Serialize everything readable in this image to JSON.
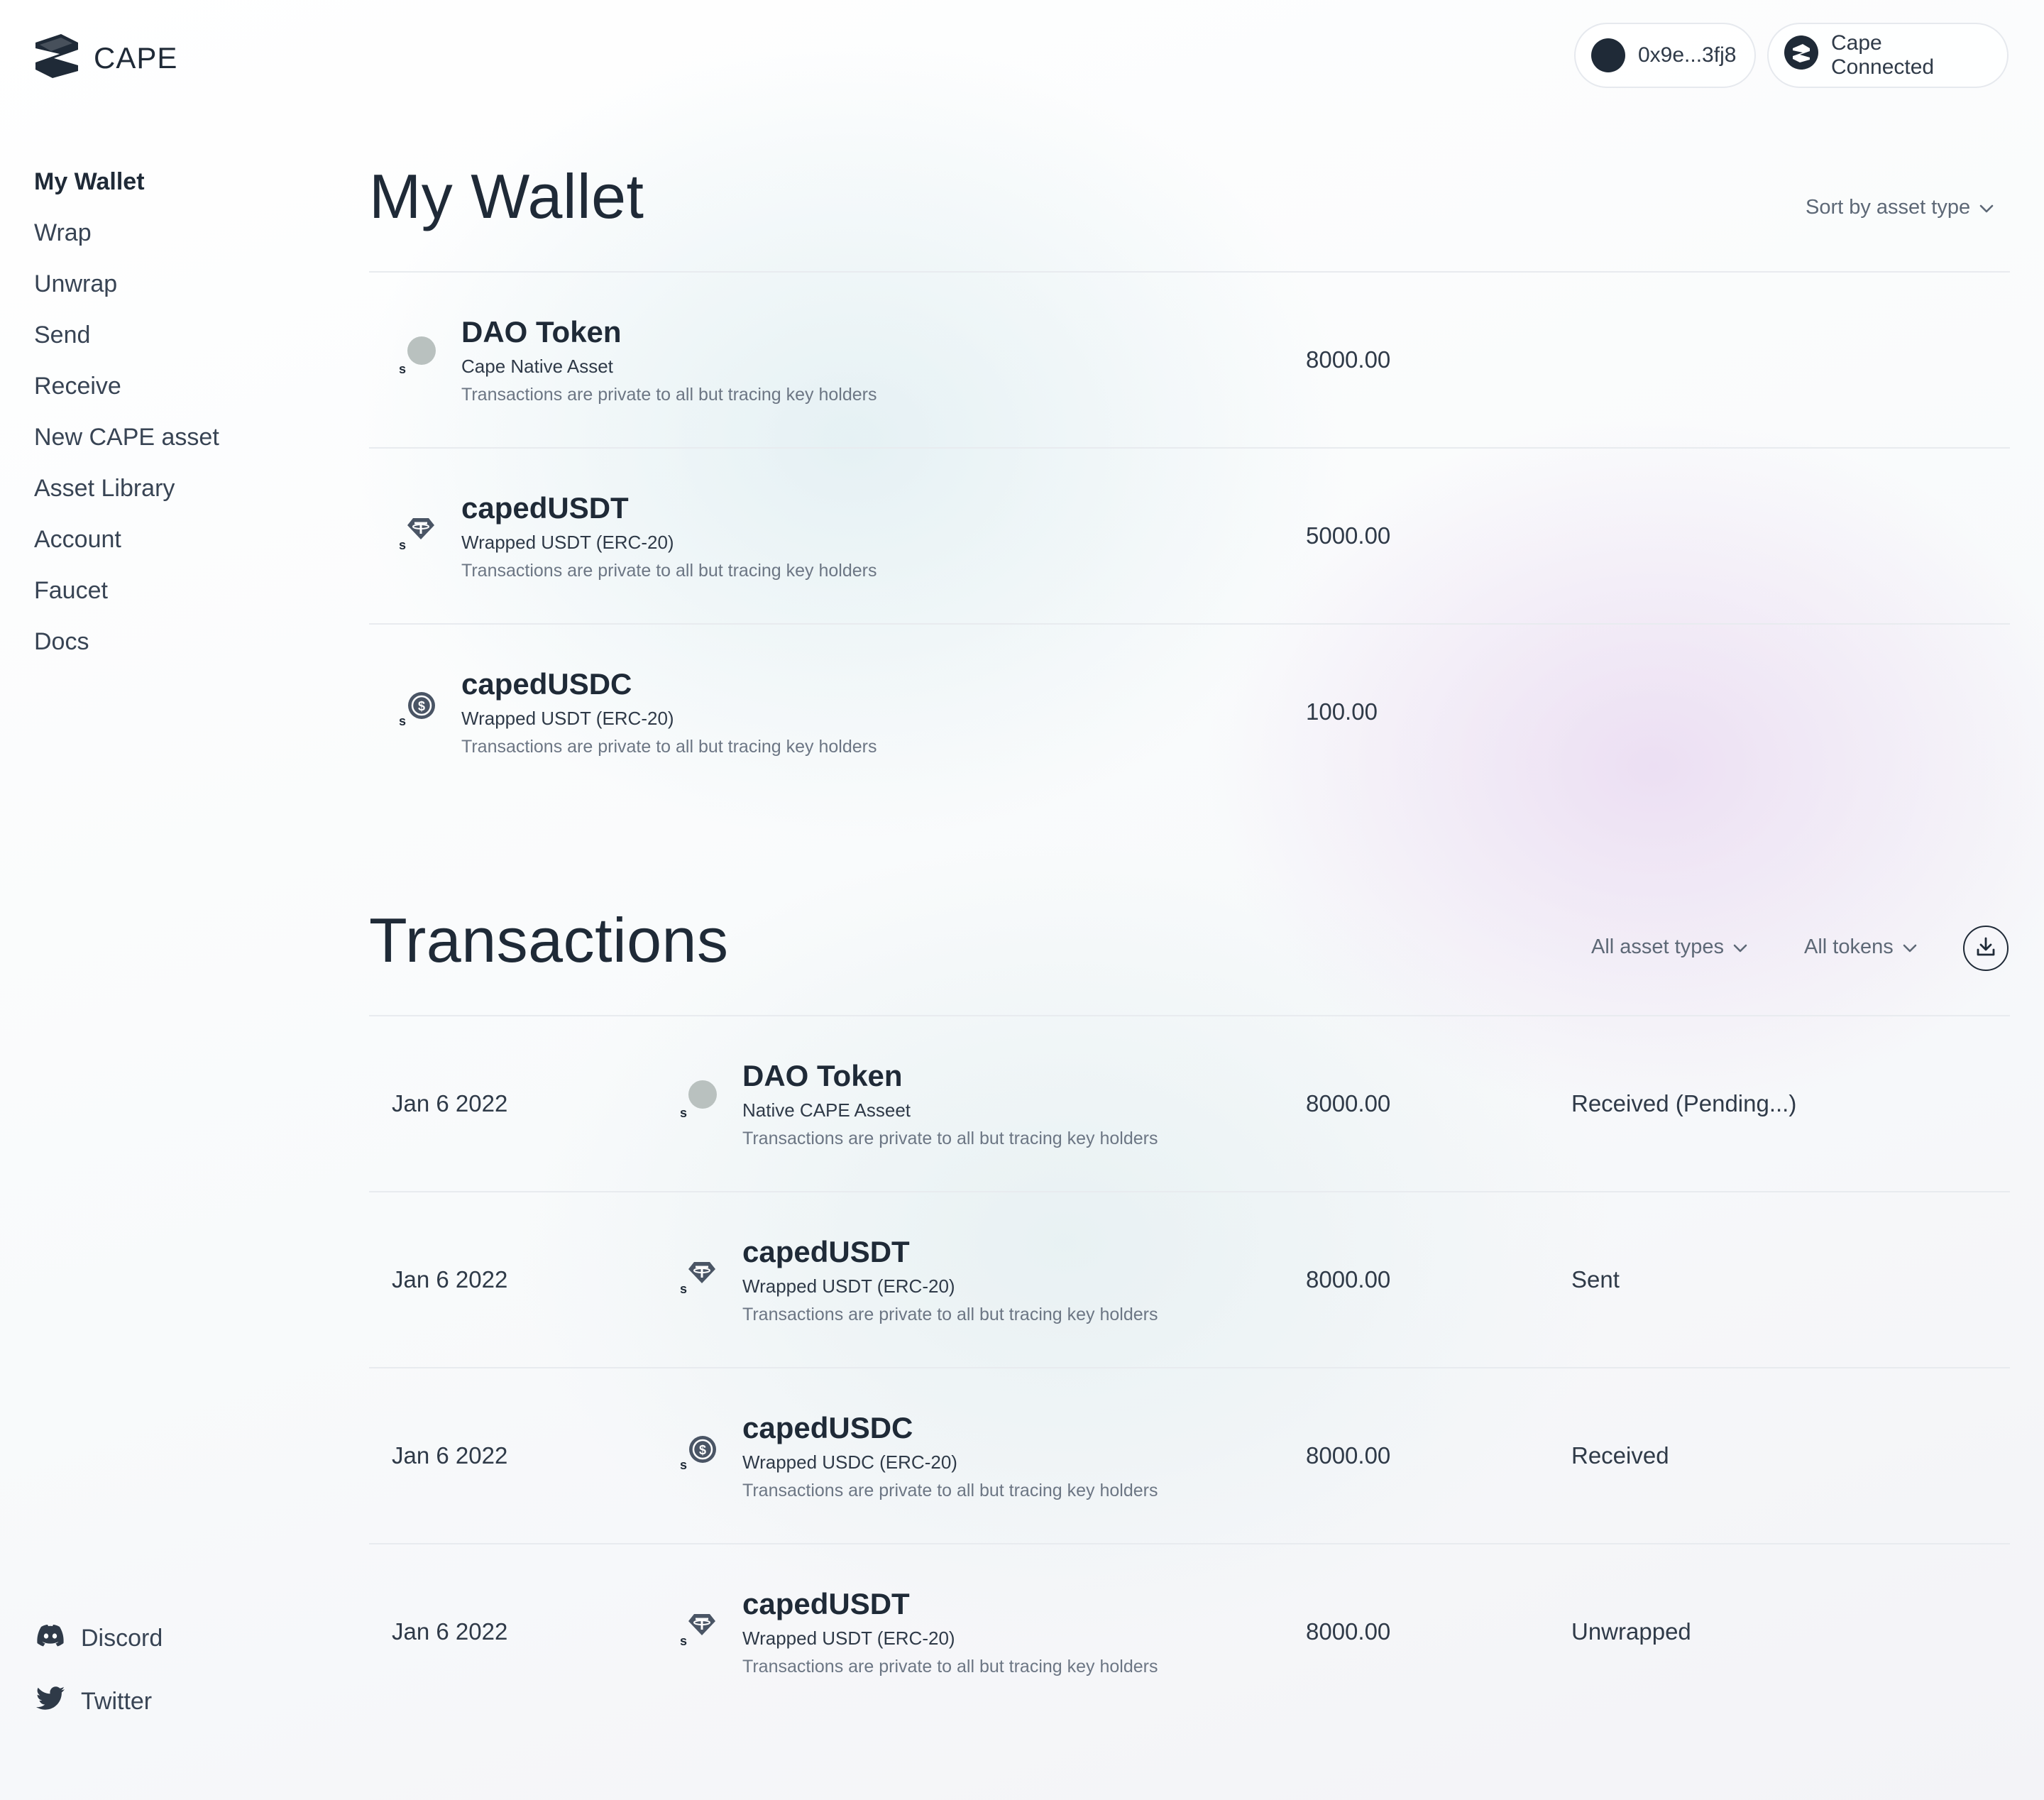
{
  "brand": {
    "name": "CAPE",
    "logo_icon": "cape-logo-icon"
  },
  "header": {
    "wallet_address": "0x9e...3fj8",
    "connection_label": "Cape Connected"
  },
  "sidebar": {
    "items": [
      {
        "label": "My Wallet",
        "active": true
      },
      {
        "label": "Wrap"
      },
      {
        "label": "Unwrap"
      },
      {
        "label": "Send"
      },
      {
        "label": "Receive"
      },
      {
        "label": "New CAPE asset"
      },
      {
        "label": "Asset Library"
      },
      {
        "label": "Account"
      },
      {
        "label": "Faucet"
      },
      {
        "label": "Docs"
      }
    ],
    "social": [
      {
        "label": "Discord",
        "icon": "discord-icon"
      },
      {
        "label": "Twitter",
        "icon": "twitter-icon"
      }
    ]
  },
  "wallet": {
    "title": "My Wallet",
    "sort_label": "Sort by asset type",
    "assets": [
      {
        "name": "DAO Token",
        "type": "Cape Native Asset",
        "note": "Transactions are private to all but tracing key holders",
        "amount": "8000.00",
        "icon": "dao-token-icon"
      },
      {
        "name": "capedUSDT",
        "type": "Wrapped USDT (ERC-20)",
        "note": "Transactions are private to all but tracing key holders",
        "amount": "5000.00",
        "icon": "usdt-icon"
      },
      {
        "name": "capedUSDC",
        "type": "Wrapped USDT (ERC-20)",
        "note": "Transactions are private to all but tracing key holders",
        "amount": "100.00",
        "icon": "usdc-icon"
      }
    ]
  },
  "transactions": {
    "title": "Transactions",
    "filter_asset_types": "All asset types",
    "filter_tokens": "All tokens",
    "download_icon": "download-icon",
    "rows": [
      {
        "date": "Jan 6 2022",
        "name": "DAO Token",
        "type": "Native CAPE Asseet",
        "note": "Transactions are private to all but tracing key holders",
        "amount": "8000.00",
        "status": "Received (Pending...)",
        "icon": "dao-token-icon"
      },
      {
        "date": "Jan 6 2022",
        "name": "capedUSDT",
        "type": "Wrapped USDT (ERC-20)",
        "note": "Transactions are private to all but tracing key holders",
        "amount": "8000.00",
        "status": "Sent",
        "icon": "usdt-icon"
      },
      {
        "date": "Jan 6 2022",
        "name": "capedUSDC",
        "type": "Wrapped USDC (ERC-20)",
        "note": "Transactions are private to all but tracing key holders",
        "amount": "8000.00",
        "status": "Received",
        "icon": "usdc-icon"
      },
      {
        "date": "Jan 6 2022",
        "name": "capedUSDT",
        "type": "Wrapped USDT (ERC-20)",
        "note": "Transactions are private to all but tracing key holders",
        "amount": "8000.00",
        "status": "Unwrapped",
        "icon": "usdt-icon"
      }
    ]
  },
  "colors": {
    "text": "#1f2a37",
    "muted": "#6c7684",
    "divider": "#e8ebef",
    "dao_token": "#b9c1bf"
  }
}
